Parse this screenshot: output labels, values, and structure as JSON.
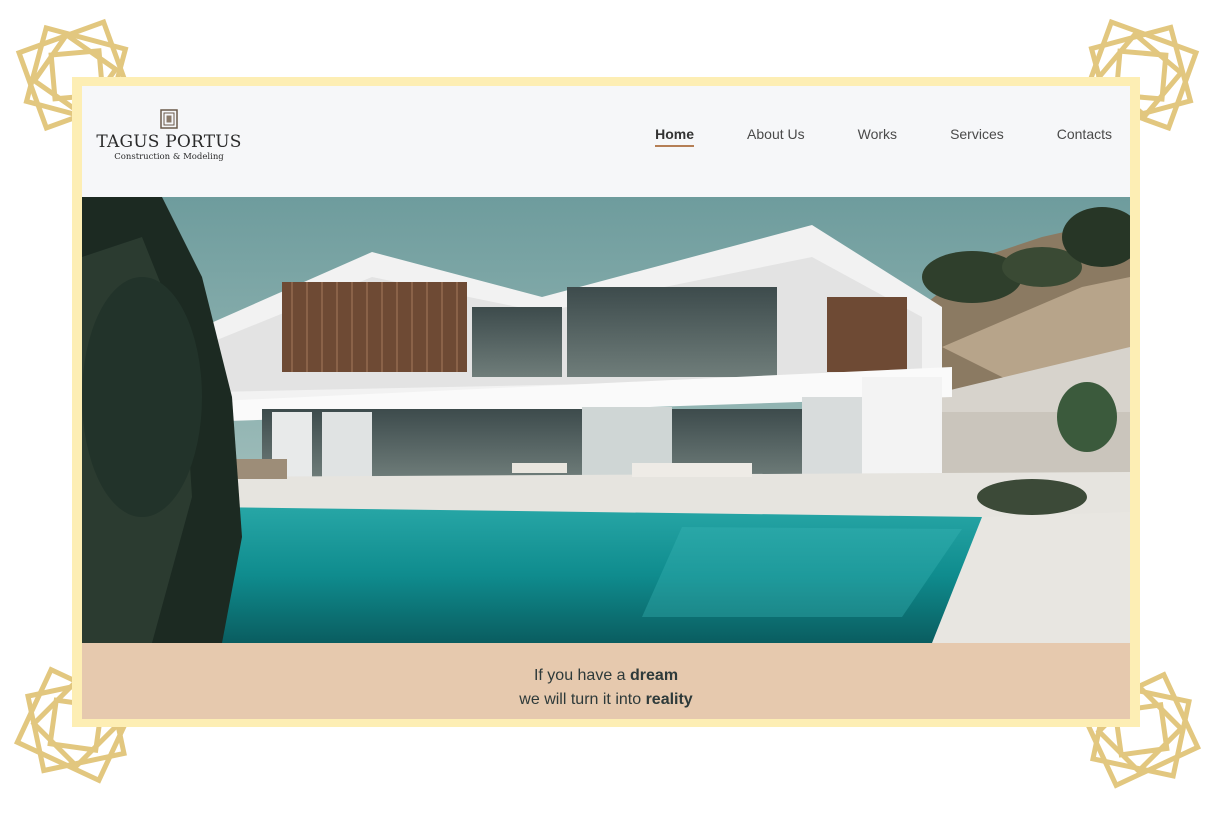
{
  "brand": {
    "name": "TAGUS PORTUS",
    "tagline": "Construction & Modeling"
  },
  "nav": {
    "items": [
      {
        "label": "Home",
        "active": true
      },
      {
        "label": "About Us",
        "active": false
      },
      {
        "label": "Works",
        "active": false
      },
      {
        "label": "Services",
        "active": false
      },
      {
        "label": "Contacts",
        "active": false
      }
    ]
  },
  "hero": {
    "image": "modern-villa-pool-photo"
  },
  "banner": {
    "line1_prefix": "If you have a ",
    "line1_emphasis": "dream",
    "line2_prefix": "we will turn it into ",
    "line2_emphasis": "reality"
  },
  "colors": {
    "frame": "#fdeeb4",
    "decor": "#e2c77f",
    "banner": "#e6c9ae",
    "nav_underline": "#b57f56"
  },
  "icons": [
    "square-frames-decor-icon",
    "logo-mark-icon"
  ]
}
